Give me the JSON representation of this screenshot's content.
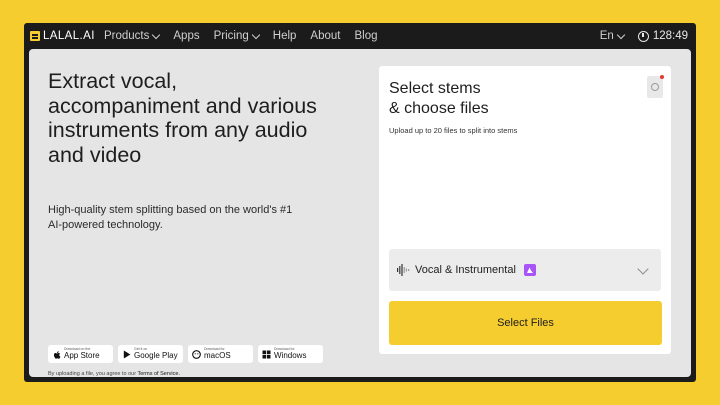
{
  "nav": {
    "logo": "LALAL.AI",
    "items": [
      {
        "label": "Products",
        "dropdown": true
      },
      {
        "label": "Apps",
        "dropdown": false
      },
      {
        "label": "Pricing",
        "dropdown": true
      },
      {
        "label": "Help",
        "dropdown": false
      },
      {
        "label": "About",
        "dropdown": false
      },
      {
        "label": "Blog",
        "dropdown": false
      }
    ],
    "language": "En",
    "timer": "128:49"
  },
  "hero": {
    "headline": "Extract vocal, accompaniment and various instruments from any audio and video",
    "subline": "High-quality stem splitting based on the world's #1 AI-powered technology."
  },
  "stores": [
    {
      "small": "Download on the",
      "big": "App Store",
      "icon": "apple-icon"
    },
    {
      "small": "Get it on",
      "big": "Google Play",
      "icon": "google-play-icon"
    },
    {
      "small": "Download for",
      "big": "macOS",
      "icon": "macos-icon"
    },
    {
      "small": "Download for",
      "big": "Windows",
      "icon": "windows-icon"
    }
  ],
  "terms": {
    "text": "By uploading a file, you agree to our ",
    "link": "Terms of Service."
  },
  "panel": {
    "title_line1": "Select stems",
    "title_line2": "& choose files",
    "subtitle": "Upload up to 20 files to split into stems",
    "stem_option": "Vocal & Instrumental",
    "button": "Select Files"
  },
  "colors": {
    "brand_yellow": "#f6cd2f",
    "frame": "#1b1b1b",
    "content_bg": "#e5e5e5",
    "badge_purple": "#a855f7",
    "notification": "#e53935"
  }
}
